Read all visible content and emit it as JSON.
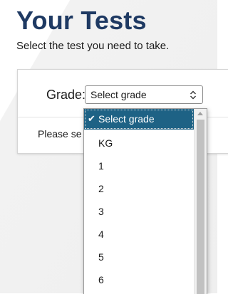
{
  "header": {
    "title": "Your Tests",
    "subtitle": "Select the test you need to take."
  },
  "grade_form": {
    "label": "Grade:",
    "select_value": "Select grade",
    "message": "Please se"
  },
  "dropdown": {
    "options": [
      "Select grade",
      "KG",
      "1",
      "2",
      "3",
      "4",
      "5",
      "6"
    ],
    "selected_index": 0,
    "check_glyph": "✔"
  },
  "colors": {
    "title": "#1f3a63",
    "selected_option_bg": "#1e6285"
  }
}
